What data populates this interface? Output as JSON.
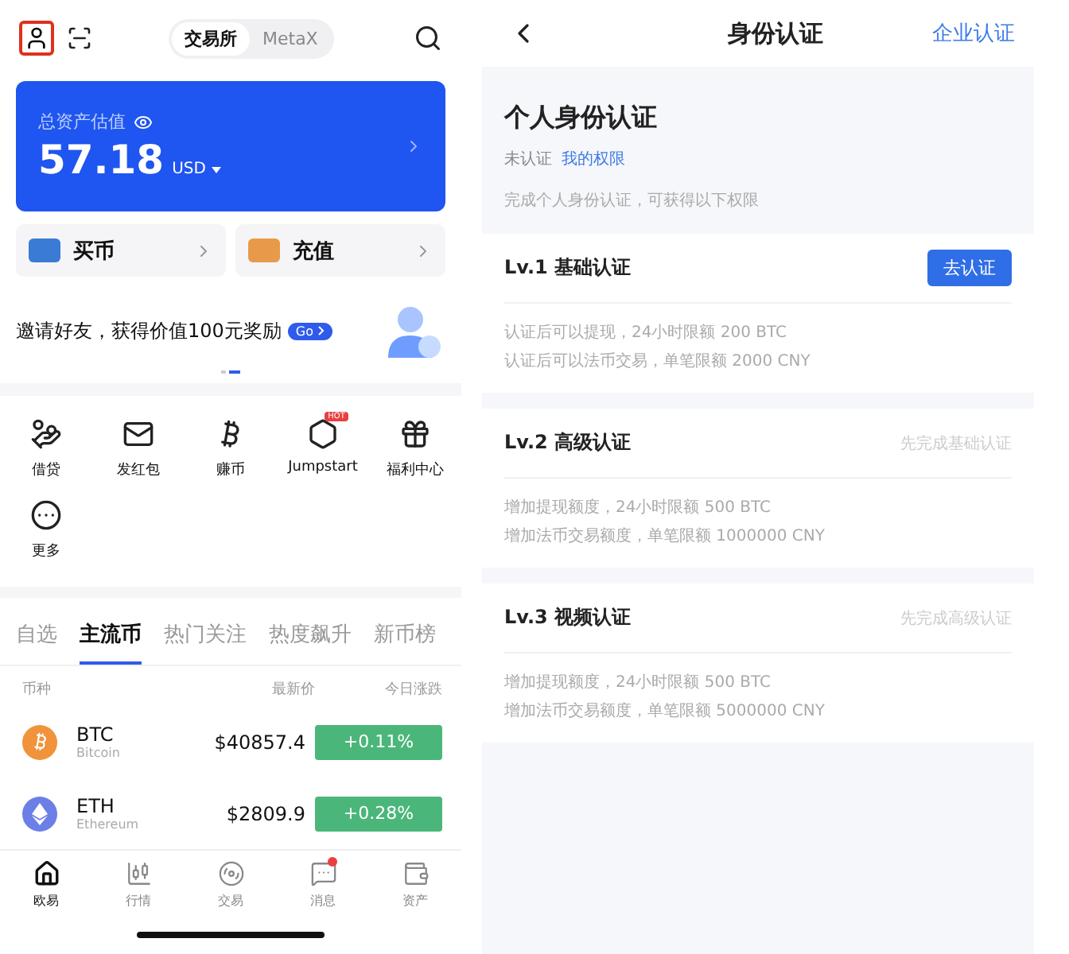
{
  "left": {
    "header": {
      "segments": [
        {
          "label": "交易所",
          "selected": true
        },
        {
          "label": "MetaX",
          "selected": false
        }
      ]
    },
    "asset_card": {
      "label": "总资产估值",
      "value": "57.18",
      "currency": "USD"
    },
    "quick_actions": [
      "买币",
      "充值"
    ],
    "banner": {
      "text": "邀请好友，获得价值100元奖励",
      "go": "Go"
    },
    "shortcuts": [
      "借贷",
      "发红包",
      "赚币",
      "Jumpstart",
      "福利中心",
      "更多"
    ],
    "shortcut_badge": "HOT",
    "market_tabs": [
      {
        "label": "自选",
        "selected": false
      },
      {
        "label": "主流币",
        "selected": true
      },
      {
        "label": "热门关注",
        "selected": false
      },
      {
        "label": "热度飙升",
        "selected": false
      },
      {
        "label": "新币榜",
        "selected": false
      }
    ],
    "columns": [
      "币种",
      "最新价",
      "今日涨跌"
    ],
    "coins": [
      {
        "symbol": "BTC",
        "name": "Bitcoin",
        "price": "$40857.4",
        "change": "+0.11%"
      },
      {
        "symbol": "ETH",
        "name": "Ethereum",
        "price": "$2809.9",
        "change": "+0.28%"
      }
    ],
    "bottom_nav": [
      {
        "label": "欧易",
        "selected": true,
        "dot": false
      },
      {
        "label": "行情",
        "selected": false,
        "dot": false
      },
      {
        "label": "交易",
        "selected": false,
        "dot": false
      },
      {
        "label": "消息",
        "selected": false,
        "dot": true
      },
      {
        "label": "资产",
        "selected": false,
        "dot": false
      }
    ]
  },
  "right": {
    "title": "身份认证",
    "link": "企业认证",
    "intro": {
      "title": "个人身份认证",
      "status": "未认证",
      "status_link": "我的权限",
      "note": "完成个人身份认证，可获得以下权限"
    },
    "levels": [
      {
        "title": "Lv.1 基础认证",
        "action": {
          "kind": "button",
          "text": "去认证"
        },
        "lines": [
          "认证后可以提现，24小时限额 200 BTC",
          "认证后可以法币交易，单笔限额 2000 CNY"
        ]
      },
      {
        "title": "Lv.2 高级认证",
        "action": {
          "kind": "hint",
          "text": "先完成基础认证"
        },
        "lines": [
          "增加提现额度，24小时限额 500 BTC",
          "增加法币交易额度，单笔限额 1000000 CNY"
        ]
      },
      {
        "title": "Lv.3 视频认证",
        "action": {
          "kind": "hint",
          "text": "先完成高级认证"
        },
        "lines": [
          "增加提现额度，24小时限额 500 BTC",
          "增加法币交易额度，单笔限额 5000000 CNY"
        ]
      }
    ]
  }
}
